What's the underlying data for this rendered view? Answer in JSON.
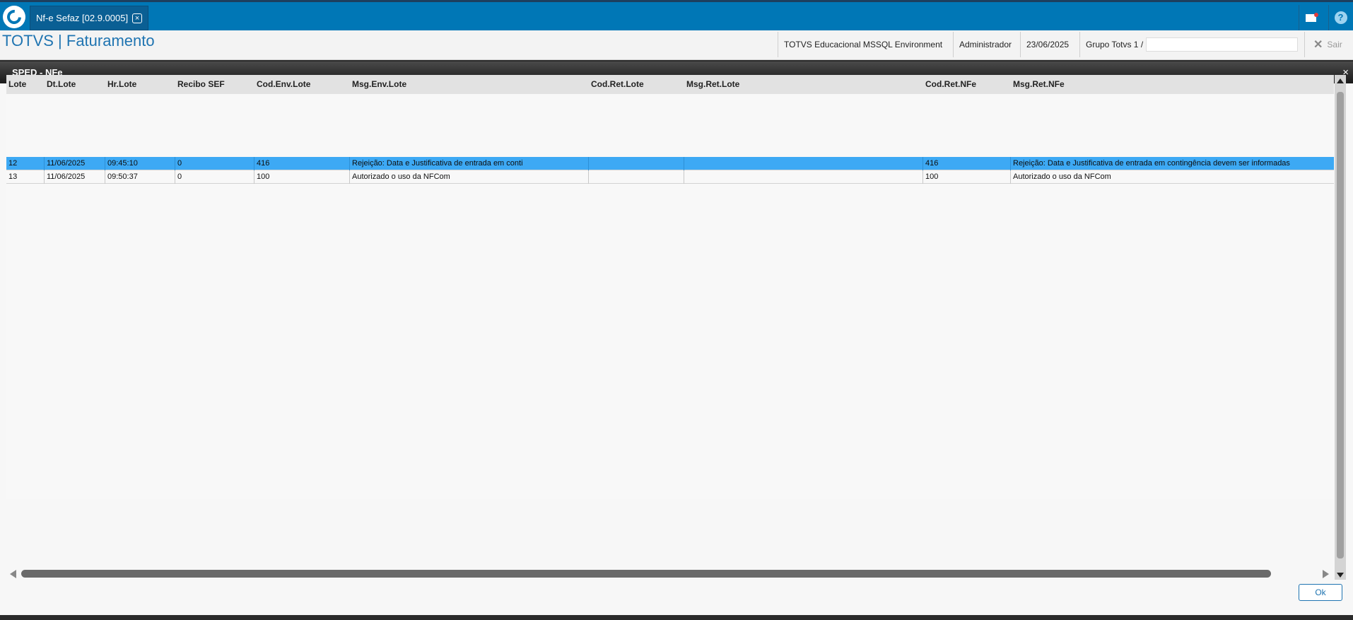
{
  "topbar": {
    "tab_label": "Nf-e Sefaz [02.9.0005]",
    "tab_close": "×"
  },
  "header": {
    "app_title": "TOTVS | Faturamento",
    "environment": "TOTVS Educacional MSSQL Environment",
    "user": "Administrador",
    "date": "23/06/2025",
    "group": "Grupo Totvs 1 /",
    "exit_label": "Sair"
  },
  "dialog": {
    "title": "SPED - NFe",
    "close": "×",
    "ok_label": "Ok"
  },
  "grid": {
    "columns": [
      "Lote",
      "Dt.Lote",
      "Hr.Lote",
      "Recibo SEF",
      "Cod.Env.Lote",
      "Msg.Env.Lote",
      "Cod.Ret.Lote",
      "Msg.Ret.Lote",
      "Cod.Ret.NFe",
      "Msg.Ret.NFe"
    ],
    "rows": [
      [
        "12",
        "11/06/2025",
        "09:45:10",
        "0",
        "416",
        "Rejeição: Data e Justificativa de entrada em conti",
        "",
        "",
        "416",
        "Rejeição: Data e Justificativa de entrada em contingência devem ser informadas"
      ],
      [
        "13",
        "11/06/2025",
        "09:50:37",
        "0",
        "100",
        "Autorizado o uso da NFCom",
        "",
        "",
        "100",
        "Autorizado o uso da NFCom"
      ]
    ],
    "selected_row": 0
  },
  "colors": {
    "brand_blue": "#0077b6",
    "selected_row": "#3da9f4"
  },
  "icons": [
    "totvs-logo-icon",
    "close-icon",
    "mail-icon",
    "help-icon",
    "exit-icon"
  ]
}
